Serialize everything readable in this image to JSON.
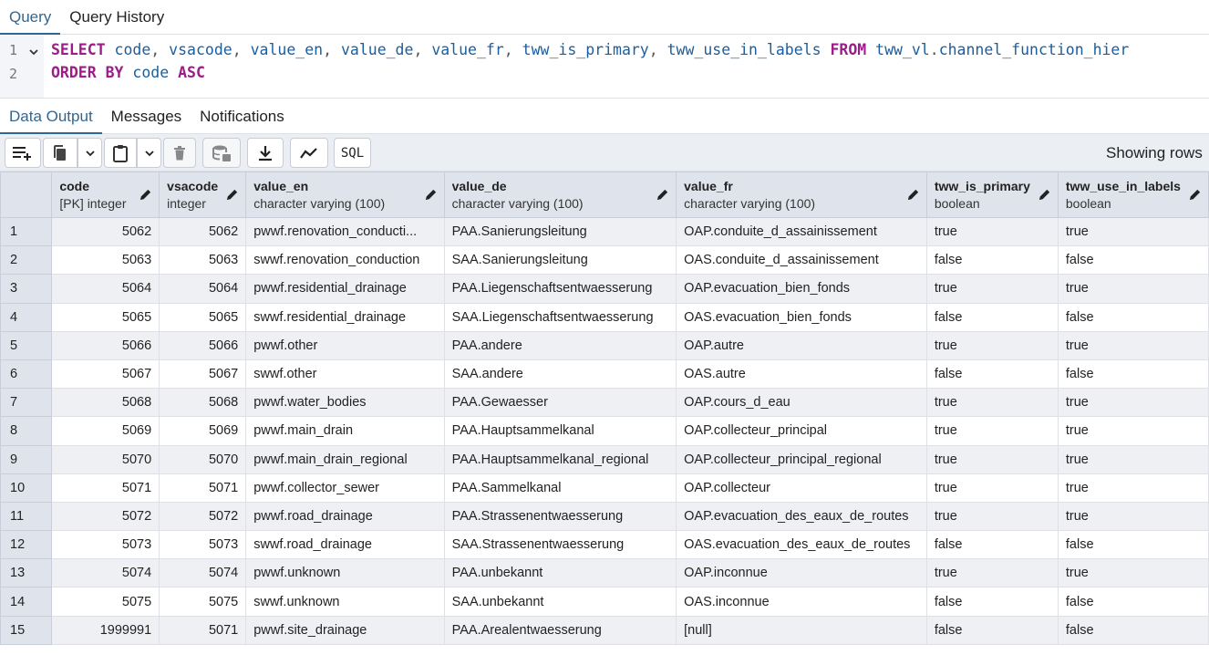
{
  "top_tabs": [
    {
      "label": "Query"
    },
    {
      "label": "Query History"
    }
  ],
  "editor": {
    "line_numbers": [
      "1",
      "2"
    ],
    "line1": [
      {
        "t": "SELECT",
        "c": "kw"
      },
      {
        "t": " ",
        "c": "pn"
      },
      {
        "t": "code",
        "c": "id"
      },
      {
        "t": ", ",
        "c": "pn"
      },
      {
        "t": "vsacode",
        "c": "id"
      },
      {
        "t": ", ",
        "c": "pn"
      },
      {
        "t": "value_en",
        "c": "id"
      },
      {
        "t": ", ",
        "c": "pn"
      },
      {
        "t": "value_de",
        "c": "id"
      },
      {
        "t": ", ",
        "c": "pn"
      },
      {
        "t": "value_fr",
        "c": "id"
      },
      {
        "t": ", ",
        "c": "pn"
      },
      {
        "t": "tww_is_primary",
        "c": "id"
      },
      {
        "t": ", ",
        "c": "pn"
      },
      {
        "t": "tww_use_in_labels",
        "c": "id"
      },
      {
        "t": " ",
        "c": "pn"
      },
      {
        "t": "FROM",
        "c": "kw"
      },
      {
        "t": " ",
        "c": "pn"
      },
      {
        "t": "tww_vl",
        "c": "id"
      },
      {
        "t": ".",
        "c": "pn"
      },
      {
        "t": "channel_function_hier",
        "c": "id"
      }
    ],
    "line2": [
      {
        "t": "ORDER BY",
        "c": "kw"
      },
      {
        "t": " ",
        "c": "pn"
      },
      {
        "t": "code",
        "c": "id"
      },
      {
        "t": " ",
        "c": "pn"
      },
      {
        "t": "ASC",
        "c": "kw"
      }
    ]
  },
  "result_tabs": [
    {
      "label": "Data Output"
    },
    {
      "label": "Messages"
    },
    {
      "label": "Notifications"
    }
  ],
  "toolbar": {
    "buttons": [
      {
        "icon": "add-row-icon"
      },
      {
        "icon": "copy-icon"
      },
      {
        "icon": "chevron-down-icon"
      },
      {
        "icon": "paste-icon"
      },
      {
        "icon": "chevron-down-icon"
      },
      {
        "icon": "delete-icon"
      },
      {
        "icon": "save-data-icon"
      },
      {
        "icon": "download-icon"
      },
      {
        "icon": "graph-icon"
      },
      {
        "icon": "sql-icon",
        "label": "SQL"
      }
    ],
    "showing_text": "Showing rows"
  },
  "grid": {
    "columns": [
      {
        "name": "code",
        "type": "[PK] integer",
        "align": "num"
      },
      {
        "name": "vsacode",
        "type": "integer",
        "align": "num"
      },
      {
        "name": "value_en",
        "type": "character varying (100)",
        "align": "txt"
      },
      {
        "name": "value_de",
        "type": "character varying (100)",
        "align": "txt"
      },
      {
        "name": "value_fr",
        "type": "character varying (100)",
        "align": "txt"
      },
      {
        "name": "tww_is_primary",
        "type": "boolean",
        "align": "txt"
      },
      {
        "name": "tww_use_in_labels",
        "type": "boolean",
        "align": "txt"
      }
    ],
    "rows": [
      [
        "1",
        "5062",
        "5062",
        "pwwf.renovation_conducti...",
        "PAA.Sanierungsleitung",
        "OAP.conduite_d_assainissement",
        "true",
        "true"
      ],
      [
        "2",
        "5063",
        "5063",
        "swwf.renovation_conduction",
        "SAA.Sanierungsleitung",
        "OAS.conduite_d_assainissement",
        "false",
        "false"
      ],
      [
        "3",
        "5064",
        "5064",
        "pwwf.residential_drainage",
        "PAA.Liegenschaftsentwaesserung",
        "OAP.evacuation_bien_fonds",
        "true",
        "true"
      ],
      [
        "4",
        "5065",
        "5065",
        "swwf.residential_drainage",
        "SAA.Liegenschaftsentwaesserung",
        "OAS.evacuation_bien_fonds",
        "false",
        "false"
      ],
      [
        "5",
        "5066",
        "5066",
        "pwwf.other",
        "PAA.andere",
        "OAP.autre",
        "true",
        "true"
      ],
      [
        "6",
        "5067",
        "5067",
        "swwf.other",
        "SAA.andere",
        "OAS.autre",
        "false",
        "false"
      ],
      [
        "7",
        "5068",
        "5068",
        "pwwf.water_bodies",
        "PAA.Gewaesser",
        "OAP.cours_d_eau",
        "true",
        "true"
      ],
      [
        "8",
        "5069",
        "5069",
        "pwwf.main_drain",
        "PAA.Hauptsammelkanal",
        "OAP.collecteur_principal",
        "true",
        "true"
      ],
      [
        "9",
        "5070",
        "5070",
        "pwwf.main_drain_regional",
        "PAA.Hauptsammelkanal_regional",
        "OAP.collecteur_principal_regional",
        "true",
        "true"
      ],
      [
        "10",
        "5071",
        "5071",
        "pwwf.collector_sewer",
        "PAA.Sammelkanal",
        "OAP.collecteur",
        "true",
        "true"
      ],
      [
        "11",
        "5072",
        "5072",
        "pwwf.road_drainage",
        "PAA.Strassenentwaesserung",
        "OAP.evacuation_des_eaux_de_routes",
        "true",
        "true"
      ],
      [
        "12",
        "5073",
        "5073",
        "swwf.road_drainage",
        "SAA.Strassenentwaesserung",
        "OAS.evacuation_des_eaux_de_routes",
        "false",
        "false"
      ],
      [
        "13",
        "5074",
        "5074",
        "pwwf.unknown",
        "PAA.unbekannt",
        "OAP.inconnue",
        "true",
        "true"
      ],
      [
        "14",
        "5075",
        "5075",
        "swwf.unknown",
        "SAA.unbekannt",
        "OAS.inconnue",
        "false",
        "false"
      ],
      [
        "15",
        "1999991",
        "5071",
        "pwwf.site_drainage",
        "PAA.Arealentwaesserung",
        "[null]",
        "false",
        "false"
      ]
    ]
  }
}
